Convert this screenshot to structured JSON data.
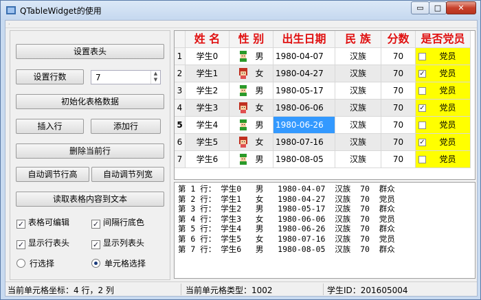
{
  "window": {
    "title": "QTableWidget的使用",
    "min": "▭",
    "max": "□",
    "close": "✕"
  },
  "left": {
    "btn_set_header": "设置表头",
    "btn_set_rows": "设置行数",
    "row_count": "7",
    "btn_init": "初始化表格数据",
    "btn_insert": "插入行",
    "btn_add": "添加行",
    "btn_delete": "删除当前行",
    "btn_auto_row": "自动调节行高",
    "btn_auto_col": "自动调节列宽",
    "btn_read": "读取表格内容到文本",
    "chk_editable": {
      "label": "表格可编辑",
      "checked": true
    },
    "chk_alt": {
      "label": "间隔行底色",
      "checked": true
    },
    "chk_rowhdr": {
      "label": "显示行表头",
      "checked": true
    },
    "chk_colhdr": {
      "label": "显示列表头",
      "checked": true
    },
    "radio_row": {
      "label": "行选择",
      "checked": false
    },
    "radio_cell": {
      "label": "单元格选择",
      "checked": true
    }
  },
  "table": {
    "headers": [
      "姓 名",
      "性 别",
      "出生日期",
      "民 族",
      "分数",
      "是否党员"
    ],
    "rows": [
      {
        "num": "1",
        "name": "学生0",
        "sex": "男",
        "birth": "1980-04-07",
        "nation": "汉族",
        "score": "70",
        "party": "党员",
        "checked": false
      },
      {
        "num": "2",
        "name": "学生1",
        "sex": "女",
        "birth": "1980-04-27",
        "nation": "汉族",
        "score": "70",
        "party": "党员",
        "checked": true
      },
      {
        "num": "3",
        "name": "学生2",
        "sex": "男",
        "birth": "1980-05-17",
        "nation": "汉族",
        "score": "70",
        "party": "党员",
        "checked": false
      },
      {
        "num": "4",
        "name": "学生3",
        "sex": "女",
        "birth": "1980-06-06",
        "nation": "汉族",
        "score": "70",
        "party": "党员",
        "checked": true
      },
      {
        "num": "5",
        "name": "学生4",
        "sex": "男",
        "birth": "1980-06-26",
        "nation": "汉族",
        "score": "70",
        "party": "党员",
        "checked": false
      },
      {
        "num": "6",
        "name": "学生5",
        "sex": "女",
        "birth": "1980-07-16",
        "nation": "汉族",
        "score": "70",
        "party": "党员",
        "checked": true
      },
      {
        "num": "7",
        "name": "学生6",
        "sex": "男",
        "birth": "1980-08-05",
        "nation": "汉族",
        "score": "70",
        "party": "党员",
        "checked": false
      }
    ],
    "colors": {
      "header_text": "#e01010",
      "party_bg": "#ffff00",
      "selection": "#3399ff"
    }
  },
  "text_output": [
    "第 1 行： 学生0   男   1980-04-07  汉族  70  群众",
    "第 2 行： 学生1   女   1980-04-27  汉族  70  党员",
    "第 3 行： 学生2   男   1980-05-17  汉族  70  群众",
    "第 4 行： 学生3   女   1980-06-06  汉族  70  党员",
    "第 5 行： 学生4   男   1980-06-26  汉族  70  群众",
    "第 6 行： 学生5   女   1980-07-16  汉族  70  党员",
    "第 7 行： 学生6   男   1980-08-05  汉族  70  群众"
  ],
  "status": {
    "coord": "当前单元格坐标：4 行，2 列",
    "type": "当前单元格类型：1002",
    "id": "学生ID：201605004"
  }
}
